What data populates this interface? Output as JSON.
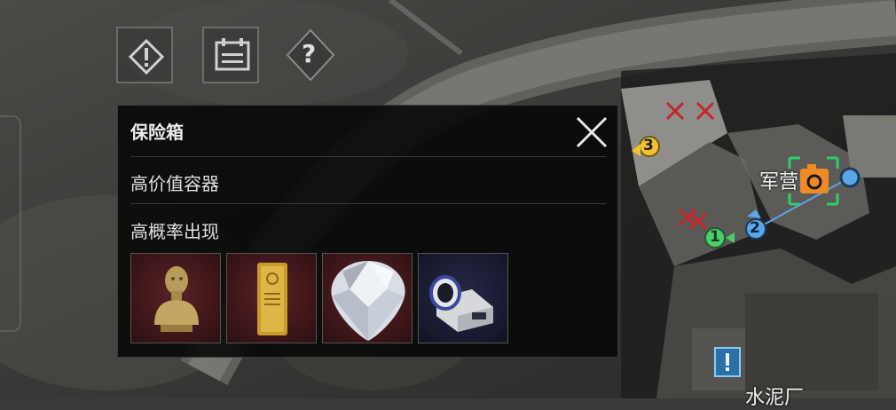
{
  "toolbar": {
    "alert_icon": "exclamation-diamond-icon",
    "calendar_icon": "calendar-icon",
    "help_label": "?"
  },
  "panel": {
    "title": "保险箱",
    "line1": "高价值容器",
    "line2": "高概率出现",
    "items": [
      {
        "icon": "bust-statue-icon",
        "rarity_color": "#5a2226"
      },
      {
        "icon": "gold-bar-icon",
        "rarity_color": "#5a2226"
      },
      {
        "icon": "diamond-icon",
        "rarity_color": "#5a2226"
      },
      {
        "icon": "device-icon",
        "rarity_color": "#262845"
      }
    ]
  },
  "map": {
    "label_barracks": "军营",
    "label_cement": "水泥厂",
    "marker_1": "1",
    "marker_2": "2",
    "marker_3": "3",
    "poi_icon": "camera-icon",
    "info_icon": "info-icon"
  },
  "colors": {
    "marker_1": "#4ecb6a",
    "marker_2": "#5aa6e6",
    "marker_3": "#f2c230",
    "poi_orange": "#f08a24",
    "poi_frame": "#2ecf6a",
    "red_cross": "#c4262a"
  }
}
